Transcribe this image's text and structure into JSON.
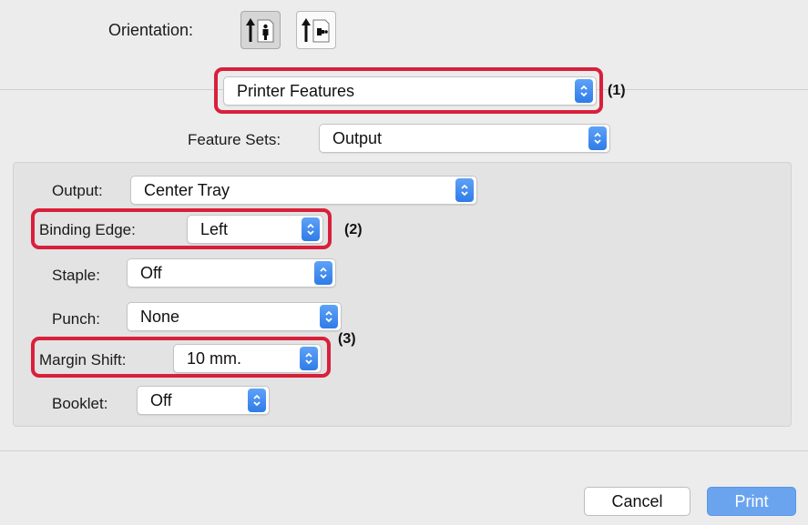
{
  "orientation": {
    "label": "Orientation:",
    "options": [
      {
        "icon": "portrait-orientation-icon",
        "selected": true
      },
      {
        "icon": "landscape-orientation-icon",
        "selected": false
      }
    ]
  },
  "panel_menu": {
    "value": "Printer Features",
    "callout": "(1)"
  },
  "feature_sets": {
    "label": "Feature Sets:",
    "value": "Output"
  },
  "settings": {
    "output": {
      "label": "Output:",
      "value": "Center Tray"
    },
    "binding_edge": {
      "label": "Binding Edge:",
      "value": "Left",
      "callout": "(2)"
    },
    "staple": {
      "label": "Staple:",
      "value": "Off"
    },
    "punch": {
      "label": "Punch:",
      "value": "None"
    },
    "margin_shift": {
      "label": "Margin Shift:",
      "value": "10 mm.",
      "callout": "(3)"
    },
    "booklet": {
      "label": "Booklet:",
      "value": "Off"
    }
  },
  "buttons": {
    "cancel": "Cancel",
    "print": "Print"
  },
  "colors": {
    "highlight": "#d8203b",
    "accent": "#3b82f0"
  }
}
